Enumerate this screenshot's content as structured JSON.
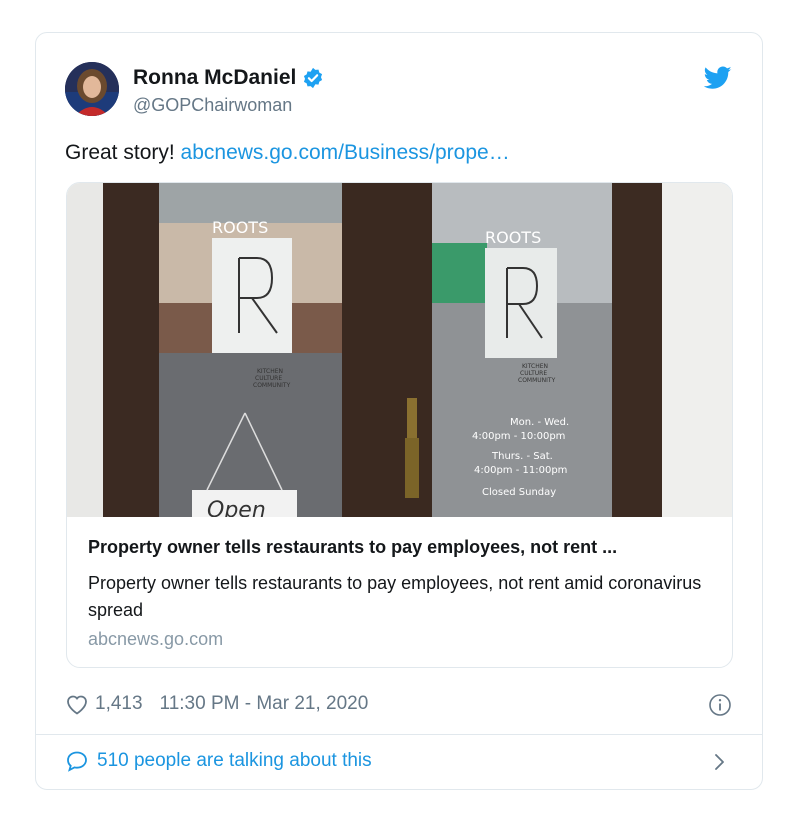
{
  "author": {
    "name": "Ronna McDaniel",
    "handle": "@GOPChairwoman"
  },
  "tweet": {
    "text_prefix": "Great story! ",
    "link_text": "abcnews.go.com/Business/prope…"
  },
  "card": {
    "title": "Property owner tells restaurants to pay employees, not rent ...",
    "description": "Property owner tells restaurants to pay employees, not rent amid coronavirus spread",
    "domain": "abcnews.go.com",
    "image_text": {
      "brand": "ROOTS",
      "letter": "R",
      "tag1": "KITCHEN",
      "tag2": "CULTURE",
      "tag3": "COMMUNITY",
      "hours1": "Mon. - Wed.",
      "hours2": "4:00pm - 10:00pm",
      "hours3": "Thurs. - Sat.",
      "hours4": "4:00pm - 11:00pm",
      "hours5": "Closed Sunday",
      "open_sign": "Open"
    }
  },
  "stats": {
    "likes": "1,413",
    "timestamp": "11:30 PM - Mar 21, 2020"
  },
  "footer": {
    "talking": "510 people are talking about this"
  },
  "colors": {
    "link": "#1b95e0",
    "verified": "#1da1f2",
    "muted": "#657786"
  },
  "icons": [
    "verified-badge-icon",
    "twitter-bird-icon",
    "heart-icon",
    "info-icon",
    "comment-bubble-icon",
    "chevron-right-icon"
  ]
}
